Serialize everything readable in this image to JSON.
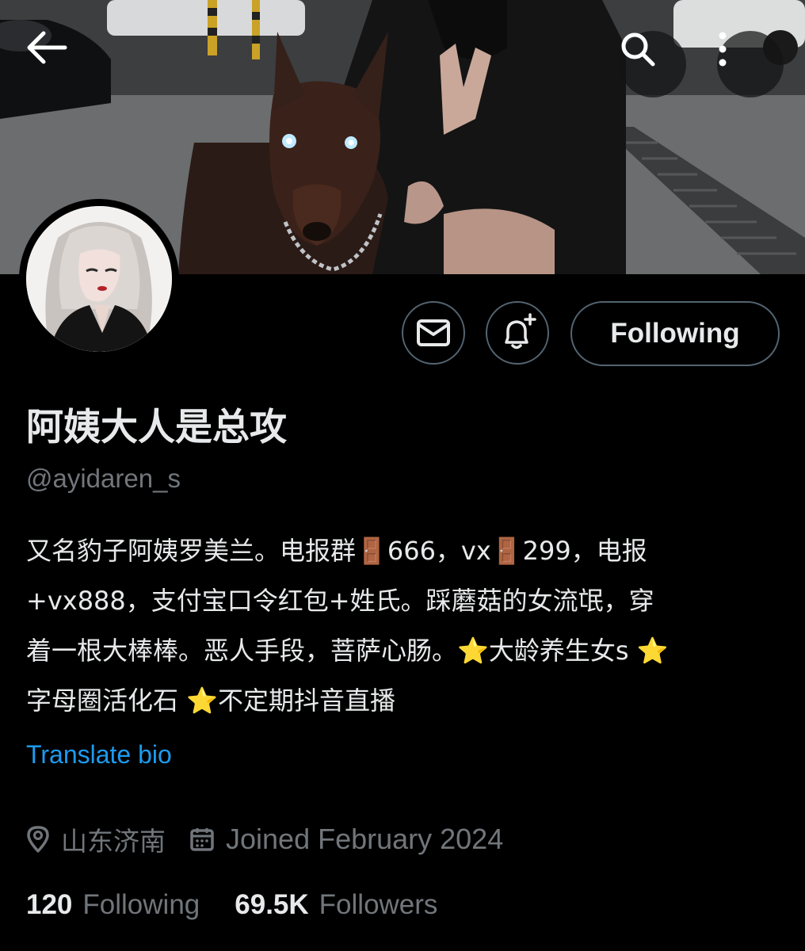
{
  "top_bar": {
    "back_icon": "arrow-left-icon",
    "search_icon": "search-icon",
    "more_icon": "more-vertical-icon"
  },
  "actions": {
    "message_icon": "envelope-icon",
    "notify_icon": "bell-plus-icon",
    "following_label": "Following"
  },
  "profile": {
    "display_name": "阿姨大人是总攻",
    "handle": "@ayidaren_s",
    "bio_lines": [
      "又名豹子阿姨罗美兰。电报群🚪666，vx🚪299，电报",
      "+vx888，支付宝口令红包+姓氏。踩蘑菇的女流氓，穿",
      "着一根大棒棒。恶人手段，菩萨心肠。⭐大龄养生女s ⭐",
      "字母圈活化石 ⭐不定期抖音直播"
    ],
    "translate_label": "Translate bio",
    "location": "山东济南",
    "joined": "Joined February 2024",
    "following_count": "120",
    "following_label": "Following",
    "followers_count": "69.5K",
    "followers_label": "Followers"
  },
  "colors": {
    "background": "#000000",
    "primary_text": "#e7e9ea",
    "secondary_text": "#71767b",
    "link": "#1d9bf0",
    "border": "#536471"
  }
}
